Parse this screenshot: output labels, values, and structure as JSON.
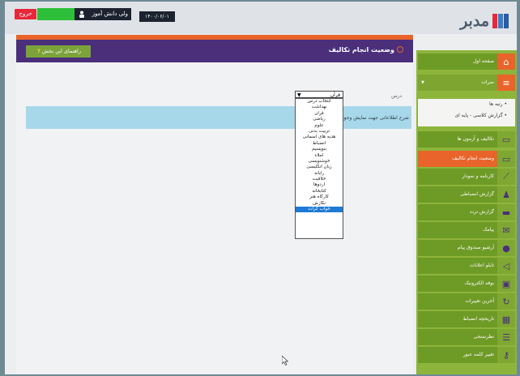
{
  "topbar": {
    "exit_label": "خروج",
    "user_name": "ولی دانش آموز",
    "date": "۱۴۰۰/۰۶/۰۱",
    "logo": "مدبر"
  },
  "header": {
    "title": "وضعیت انجام تکالیف",
    "help_label": "راهنمای این بخش"
  },
  "filter": {
    "course_label": "درس",
    "course_selected": "قرآن"
  },
  "info": {
    "text": "شرح اطلاعاتی جهت نمایش وجود ندارد"
  },
  "dropdown": {
    "options": [
      "انتخاب درس",
      "بهداشت",
      "قرآن",
      "ریاضی",
      "علوم",
      "تربیت بدنی",
      "هدیه های آسمانی",
      "انضباط",
      "بنویسیم",
      "املاء",
      "خوشنویسی",
      "زبان انگلیسی",
      "رایانه",
      "خلاقیت",
      "اردوها",
      "کتابخانه",
      "کارگاه هنر",
      "نگارش",
      "خواب کرات"
    ],
    "selected_index": 18
  },
  "sidebar": {
    "items": [
      {
        "label": "صفحه اول",
        "icon": "home-icon"
      },
      {
        "label": "نمرات",
        "icon": "grades-icon"
      },
      {
        "label": "تکالیف و آزمون ها",
        "icon": "book-icon"
      },
      {
        "label": "وضعیت انجام تکالیف",
        "icon": "book-icon"
      },
      {
        "label": "کارنامه و نمودار",
        "icon": "chart-icon"
      },
      {
        "label": "گزارش انضباطی",
        "icon": "person-icon"
      },
      {
        "label": "گزارش تردد",
        "icon": "card-icon"
      },
      {
        "label": "پیامک",
        "icon": "mail-icon"
      },
      {
        "label": "آرشیو صندوق پیام",
        "icon": "chat-icon"
      },
      {
        "label": "تابلو اعلانات",
        "icon": "megaphone-icon"
      },
      {
        "label": "بوفه الکترونیک",
        "icon": "shop-icon"
      },
      {
        "label": "آخرین تغییرات",
        "icon": "refresh-icon"
      },
      {
        "label": "تاریخچه انضباط",
        "icon": "calendar-icon"
      },
      {
        "label": "نظرسنجی",
        "icon": "list-icon"
      },
      {
        "label": "تغییر کلمه عبور",
        "icon": "key-icon"
      }
    ],
    "submenu": [
      "رتبه ها",
      "گزارش کلاسی - پایه ای"
    ]
  },
  "colors": {
    "sidebar": "#8db53c",
    "active": "#e8642a",
    "header": "#4b2f7b",
    "exit": "#e8273a"
  }
}
